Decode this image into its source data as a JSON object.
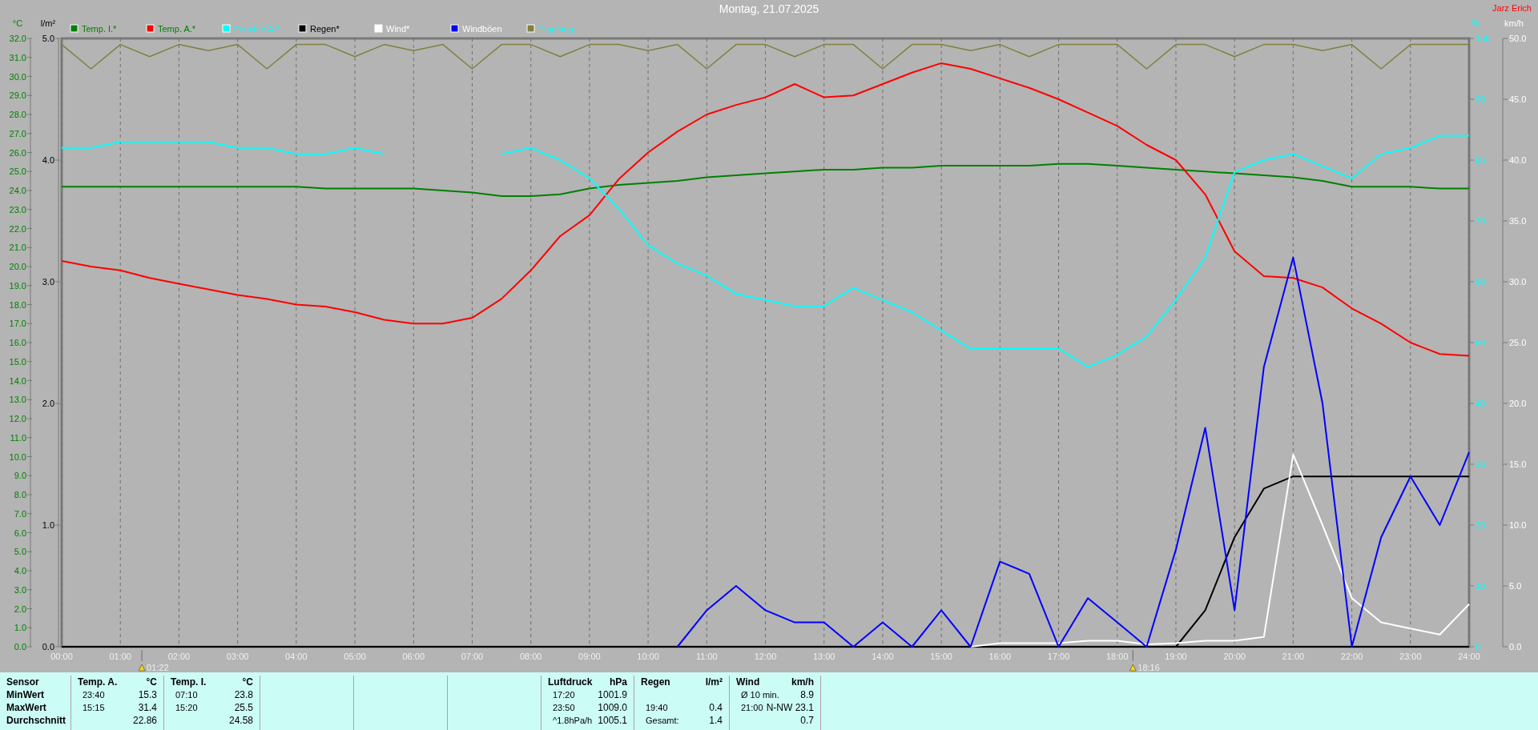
{
  "header": {
    "title": "Montag, 21.07.2025",
    "author": "Jarz Erich"
  },
  "chart": {
    "axes": [
      {
        "color": "#008000"
      },
      {
        "color": "#00ffff"
      },
      {
        "color": "#000000"
      }
    ],
    "sun_marks": [
      {
        "time": "01:22"
      },
      {
        "time": "18:16"
      }
    ],
    "chart_data": {
      "type": "line",
      "legend": "top",
      "grid": true,
      "xlim": [
        0,
        24
      ],
      "ylim": [
        0,
        32
      ],
      "y2lim": [
        0,
        100
      ],
      "y3lim": [
        0,
        5
      ],
      "ylabel": "°C",
      "y2label": "%",
      "y3label": "l/m²",
      "yticks": [
        {
          "value": 32,
          "label": "32.0"
        },
        {
          "value": 31,
          "label": "31.0"
        },
        {
          "value": 30,
          "label": "30.0"
        },
        {
          "value": 29,
          "label": "29.0"
        },
        {
          "value": 28,
          "label": "28.0"
        },
        {
          "value": 27,
          "label": "27.0"
        },
        {
          "value": 26,
          "label": "26.0"
        },
        {
          "value": 25,
          "label": "25.0"
        },
        {
          "value": 24,
          "label": "24.0"
        },
        {
          "value": 23,
          "label": "23.0"
        },
        {
          "value": 22,
          "label": "22.0"
        },
        {
          "value": 21,
          "label": "21.0"
        },
        {
          "value": 20,
          "label": "20.0"
        },
        {
          "value": 19,
          "label": "19.0"
        },
        {
          "value": 18,
          "label": "18.0"
        },
        {
          "value": 17,
          "label": "17.0"
        },
        {
          "value": 16,
          "label": "16.0"
        },
        {
          "value": 15,
          "label": "15.0"
        },
        {
          "value": 14,
          "label": "14.0"
        },
        {
          "value": 13,
          "label": "13.0"
        },
        {
          "value": 12,
          "label": "12.0"
        },
        {
          "value": 11,
          "label": "11.0"
        },
        {
          "value": 10,
          "label": "10.0"
        },
        {
          "value": 9,
          "label": "9.0"
        },
        {
          "value": 8,
          "label": "8.0"
        },
        {
          "value": 7,
          "label": "7.0"
        },
        {
          "value": 6,
          "label": "6.0"
        },
        {
          "value": 5,
          "label": "5.0"
        },
        {
          "value": 4,
          "label": "4.0"
        },
        {
          "value": 3,
          "label": "3.0"
        },
        {
          "value": 2,
          "label": "2.0"
        },
        {
          "value": 1,
          "label": "1.0"
        },
        {
          "value": 0,
          "label": "0.0"
        }
      ],
      "y2ticks": [
        100,
        90,
        80,
        70,
        60,
        50,
        40,
        30,
        20,
        10,
        0
      ],
      "y3ticks": [
        {
          "value": 5,
          "label": "5.0"
        },
        {
          "value": 4,
          "label": "4.0"
        },
        {
          "value": 3,
          "label": "3.0"
        },
        {
          "value": 2,
          "label": "2.0"
        },
        {
          "value": 1,
          "label": "1.0"
        },
        {
          "value": 0,
          "label": "0.0"
        }
      ],
      "x": [
        0,
        0.5,
        1,
        1.5,
        2,
        2.5,
        3,
        3.5,
        4,
        4.5,
        5,
        5.5,
        6,
        6.5,
        7,
        7.5,
        8,
        8.5,
        9,
        9.5,
        10,
        10.5,
        11,
        11.5,
        12,
        12.5,
        13,
        13.5,
        14,
        14.5,
        15,
        15.5,
        16,
        16.5,
        17,
        17.5,
        18,
        18.5,
        19,
        19.5,
        20,
        20.5,
        21,
        21.5,
        22,
        22.5,
        23,
        23.5,
        24
      ],
      "xticks": [
        {
          "value": 0,
          "label": "00:00"
        },
        {
          "value": 1,
          "label": "01:00"
        },
        {
          "value": 2,
          "label": "02:00"
        },
        {
          "value": 3,
          "label": "03:00"
        },
        {
          "value": 4,
          "label": "04:00"
        },
        {
          "value": 5,
          "label": "05:00"
        },
        {
          "value": 6,
          "label": "06:00"
        },
        {
          "value": 7,
          "label": "07:00"
        },
        {
          "value": 8,
          "label": "08:00"
        },
        {
          "value": 9,
          "label": "09:00"
        },
        {
          "value": 10,
          "label": "10:00"
        },
        {
          "value": 11,
          "label": "11:00"
        },
        {
          "value": 12,
          "label": "12:00"
        },
        {
          "value": 13,
          "label": "13:00"
        },
        {
          "value": 14,
          "label": "14:00"
        },
        {
          "value": 15,
          "label": "15:00"
        },
        {
          "value": 16,
          "label": "16:00"
        },
        {
          "value": 17,
          "label": "17:00"
        },
        {
          "value": 18,
          "label": "18:00"
        },
        {
          "value": 19,
          "label": "19:00"
        },
        {
          "value": 20,
          "label": "20:00"
        },
        {
          "value": 21,
          "label": "21:00"
        },
        {
          "value": 22,
          "label": "22:00"
        },
        {
          "value": 23,
          "label": "23:00"
        },
        {
          "value": 24,
          "label": "24:00"
        }
      ],
      "series": [
        {
          "name": "Temp. I.*",
          "color": "#008000",
          "values": [
            24.2,
            24.2,
            24.2,
            24.2,
            24.2,
            24.2,
            24.2,
            24.2,
            24.2,
            24.1,
            24.1,
            24.1,
            24.1,
            24.0,
            23.9,
            23.7,
            23.7,
            23.8,
            24.1,
            24.3,
            24.4,
            24.5,
            24.7,
            24.8,
            24.9,
            25.0,
            25.1,
            25.1,
            25.2,
            25.2,
            25.3,
            25.3,
            25.3,
            25.3,
            25.4,
            25.4,
            25.3,
            25.2,
            25.1,
            25.0,
            24.9,
            24.8,
            24.7,
            24.5,
            24.2,
            24.2,
            24.2,
            24.1,
            24.1
          ]
        },
        {
          "name": "Temp. A.*",
          "color": "#ff0000",
          "values": [
            20.3,
            20.0,
            19.8,
            19.4,
            19.1,
            18.8,
            18.5,
            18.3,
            18.0,
            17.9,
            17.6,
            17.2,
            17.0,
            17.0,
            17.3,
            18.3,
            19.8,
            21.6,
            22.7,
            24.6,
            26.0,
            27.1,
            28.0,
            28.5,
            28.9,
            29.6,
            28.9,
            29.0,
            29.6,
            30.2,
            30.7,
            30.4,
            29.9,
            29.4,
            28.8,
            28.1,
            27.4,
            26.4,
            25.6,
            23.8,
            20.8,
            19.5,
            19.4,
            18.9,
            17.8,
            17.0,
            16.0,
            15.4,
            15.3
          ]
        },
        {
          "name": "Feuchte A.*",
          "color": "#00ffff",
          "axis": "y2",
          "values": [
            82,
            82,
            83,
            83,
            83,
            83,
            82,
            82,
            81,
            81,
            82,
            81,
            null,
            null,
            null,
            81,
            82,
            80,
            77,
            72,
            66,
            63,
            61,
            58,
            57,
            56,
            56,
            59,
            57,
            55,
            52,
            49,
            49,
            49,
            49,
            46,
            48,
            51,
            57,
            64,
            78,
            80,
            81,
            79,
            77,
            81,
            82,
            84,
            84
          ]
        },
        {
          "name": "Regen*",
          "color": "#000000",
          "axis": "y3",
          "values": [
            0,
            0,
            0,
            0,
            0,
            0,
            0,
            0,
            0,
            0,
            0,
            0,
            0,
            0,
            0,
            0,
            0,
            0,
            0,
            0,
            0,
            0,
            0,
            0,
            0,
            0,
            0,
            0,
            0,
            0,
            0,
            0,
            0,
            0,
            0,
            0,
            0,
            0,
            0,
            0.3,
            0.9,
            1.3,
            1.4,
            1.4,
            1.4,
            1.4,
            1.4,
            1.4,
            1.4
          ]
        },
        {
          "name": "Empfang",
          "color": "#808040",
          "axis": "y2",
          "values": [
            99,
            95,
            99,
            97,
            99,
            98,
            99,
            95,
            99,
            99,
            97,
            99,
            98,
            99,
            95,
            99,
            99,
            97,
            99,
            99,
            98,
            99,
            95,
            99,
            99,
            97,
            99,
            99,
            95,
            99,
            99,
            98,
            99,
            97,
            99,
            99,
            99,
            95,
            99,
            99,
            97,
            99,
            99,
            98,
            99,
            95,
            99,
            99,
            99
          ]
        }
      ]
    }
  },
  "wind_chart": {
    "axes": [
      {
        "color": "#ffffff"
      }
    ],
    "chart_data": {
      "type": "line",
      "legend": "top",
      "ylim": [
        0,
        50
      ],
      "ylabel": "km/h",
      "yticks": [
        {
          "value": 50,
          "label": "50.0"
        },
        {
          "value": 45,
          "label": "45.0"
        },
        {
          "value": 40,
          "label": "40.0"
        },
        {
          "value": 35,
          "label": "35.0"
        },
        {
          "value": 30,
          "label": "30.0"
        },
        {
          "value": 25,
          "label": "25.0"
        },
        {
          "value": 20,
          "label": "20.0"
        },
        {
          "value": 15,
          "label": "15.0"
        },
        {
          "value": 10,
          "label": "10.0"
        },
        {
          "value": 5,
          "label": "5.0"
        },
        {
          "value": 0,
          "label": "0.0"
        }
      ],
      "series": [
        {
          "name": "Wind*",
          "color": "#ffffff",
          "values": [
            null,
            null,
            null,
            null,
            null,
            null,
            null,
            null,
            null,
            null,
            null,
            null,
            null,
            null,
            null,
            null,
            null,
            null,
            null,
            null,
            null,
            null,
            null,
            null,
            null,
            null,
            null,
            null,
            null,
            null,
            null,
            0,
            0.3,
            0.3,
            0.3,
            0.5,
            0.5,
            0.2,
            0.3,
            0.5,
            0.5,
            0.8,
            15.8,
            10,
            4,
            2,
            1.5,
            1,
            3.5
          ]
        },
        {
          "name": "Windböen",
          "color": "#0000ff",
          "values": [
            null,
            null,
            null,
            null,
            null,
            null,
            null,
            null,
            null,
            null,
            null,
            null,
            null,
            null,
            null,
            null,
            null,
            null,
            null,
            null,
            null,
            0,
            3,
            5,
            3,
            2,
            2,
            0,
            2,
            0,
            3,
            0,
            7,
            6,
            0,
            4,
            2,
            0,
            8,
            18,
            3,
            23,
            32,
            20,
            0,
            9,
            14,
            10,
            16
          ]
        }
      ]
    }
  },
  "stats": {
    "row_labels": [
      "Sensor",
      "MinWert",
      "MaxWert",
      "Durchschnitt"
    ],
    "sections": [
      {
        "kind": "data",
        "title": "Temp. A.",
        "unit": "°C",
        "rows": [
          {
            "time": "23:40",
            "value": "15.3"
          },
          {
            "time": "15:15",
            "value": "31.4"
          },
          {
            "value": "22.86"
          }
        ]
      },
      {
        "kind": "data",
        "title": "Temp. I.",
        "unit": "°C",
        "rows": [
          {
            "time": "07:10",
            "value": "23.8"
          },
          {
            "time": "15:20",
            "value": "25.5"
          },
          {
            "value": "24.58"
          }
        ]
      },
      {
        "kind": "empty"
      },
      {
        "kind": "empty"
      },
      {
        "kind": "empty"
      },
      {
        "kind": "data",
        "title": "Luftdruck",
        "unit": "hPa",
        "rows": [
          {
            "time": "17:20",
            "value": "1001.9"
          },
          {
            "time": "23:50",
            "value": "1009.0"
          },
          {
            "time": "^1.8hPa/h",
            "value": "1005.1"
          }
        ]
      },
      {
        "kind": "data",
        "title": "Regen",
        "unit": "l/m²",
        "rows": [
          {},
          {
            "time": "19:40",
            "value": "0.4"
          },
          {
            "time": "Gesamt:",
            "value": "1.4"
          }
        ]
      },
      {
        "kind": "data",
        "title": "Wind",
        "unit": "km/h",
        "rows": [
          {
            "time": "Ø 10 min.",
            "value": "8.9"
          },
          {
            "time": "21:00",
            "value": "N-NW 23.1"
          },
          {
            "value": "0.7"
          }
        ]
      }
    ]
  }
}
